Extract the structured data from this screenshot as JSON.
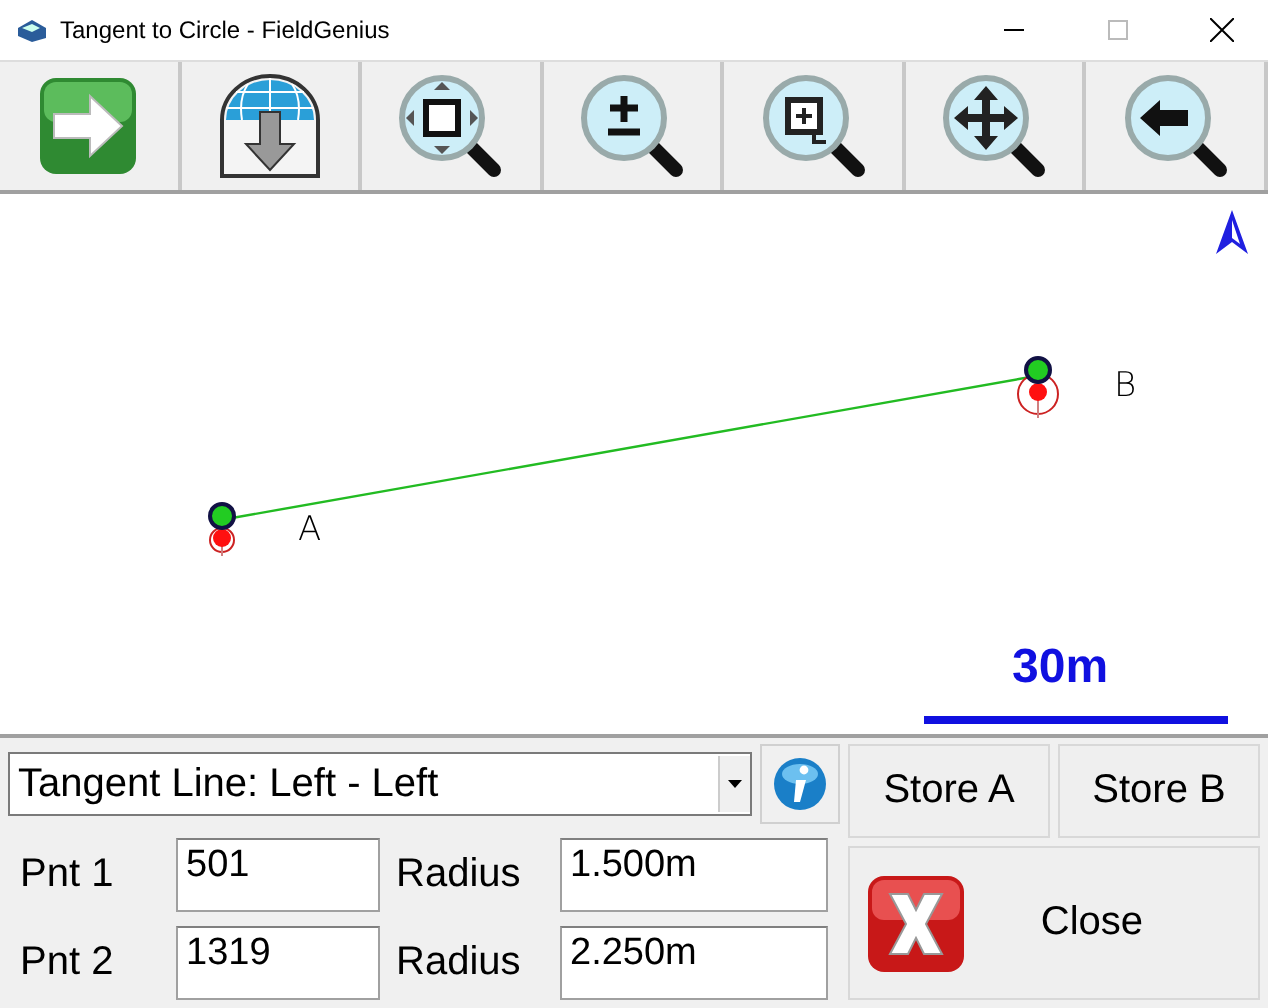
{
  "window": {
    "title": "Tangent to Circle - FieldGenius"
  },
  "map": {
    "points": [
      {
        "label": "A"
      },
      {
        "label": "B"
      }
    ],
    "scale": "30m"
  },
  "form": {
    "mode": "Tangent Line: Left - Left",
    "rows": [
      {
        "label": "Pnt 1",
        "value": "501",
        "radius_label": "Radius",
        "radius": "1.500m"
      },
      {
        "label": "Pnt 2",
        "value": "1319",
        "radius_label": "Radius",
        "radius": "2.250m"
      }
    ],
    "store_buttons": [
      "Store A",
      "Store B"
    ],
    "close": "Close"
  }
}
